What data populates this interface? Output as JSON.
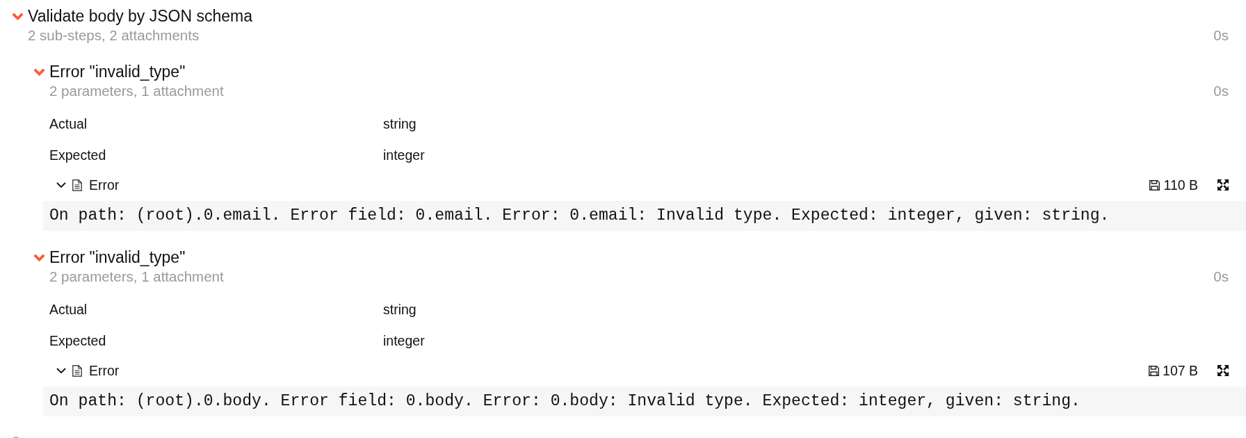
{
  "steps": [
    {
      "color": "#fd5a3e",
      "expanded": true,
      "title": "Validate body by JSON schema",
      "summary": "2 sub-steps, 2 attachments",
      "duration": "0s",
      "children": [
        {
          "color": "#fd5a3e",
          "expanded": true,
          "title": "Error \"invalid_type\"",
          "summary": "2 parameters, 1 attachment",
          "duration": "0s",
          "parameters": [
            {
              "name": "Actual",
              "value": "string"
            },
            {
              "name": "Expected",
              "value": "integer"
            }
          ],
          "attachments": [
            {
              "kind": "text",
              "expanded": true,
              "name": "Error",
              "size": "110 B",
              "content": "On path: (root).0.email. Error field: 0.email. Error: 0.email: Invalid type. Expected: integer, given: string."
            }
          ]
        },
        {
          "color": "#fd5a3e",
          "expanded": true,
          "title": "Error \"invalid_type\"",
          "summary": "2 parameters, 1 attachment",
          "duration": "0s",
          "parameters": [
            {
              "name": "Actual",
              "value": "string"
            },
            {
              "name": "Expected",
              "value": "integer"
            }
          ],
          "attachments": [
            {
              "kind": "text",
              "expanded": true,
              "name": "Error",
              "size": "107 B",
              "content": "On path: (root).0.body. Error field: 0.body. Error: 0.body: Invalid type. Expected: integer, given: string."
            }
          ]
        }
      ]
    },
    {
      "color": "#97cc64"
    }
  ]
}
